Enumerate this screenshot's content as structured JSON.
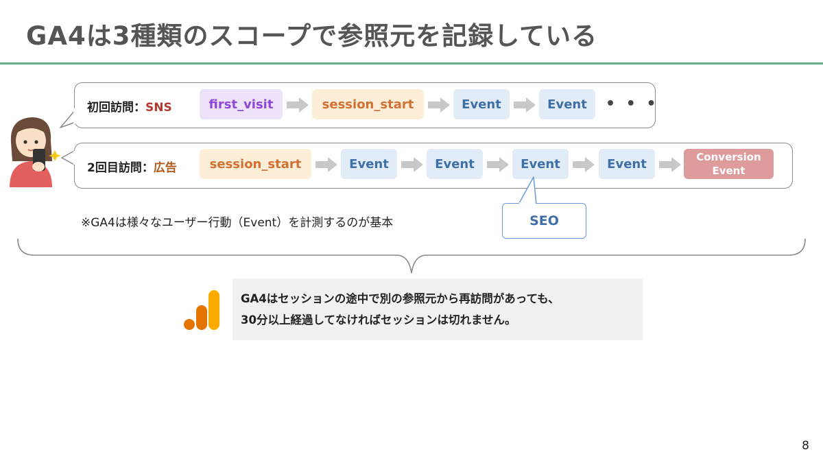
{
  "slide": {
    "title": "GA4は3種類のスコープで参照元を記録している",
    "page_number": "8",
    "accent_color": "#6aae8a"
  },
  "visit1": {
    "label": "初回訪問：",
    "source": "SNS",
    "chips": [
      "first_visit",
      "session_start",
      "Event",
      "Event"
    ],
    "more": "• • •"
  },
  "visit2": {
    "label": "2回目訪問：",
    "source": "広告",
    "chips": [
      "session_start",
      "Event",
      "Event",
      "Event",
      "Event"
    ],
    "conversion_line1": "Conversion",
    "conversion_line2": "Event"
  },
  "note": "※GA4は様々なユーザー行動（Event）を計測するのが基本",
  "callout": "SEO",
  "summary": {
    "line1": "GA4はセッションの途中で別の参照元から再訪問があっても、",
    "line2": "30分以上経過してなければセッションは切れません。"
  },
  "icons": {
    "logo": "google-analytics-logo",
    "person": "person-with-smartphone-illustration",
    "arrow": "right-arrow-icon"
  }
}
